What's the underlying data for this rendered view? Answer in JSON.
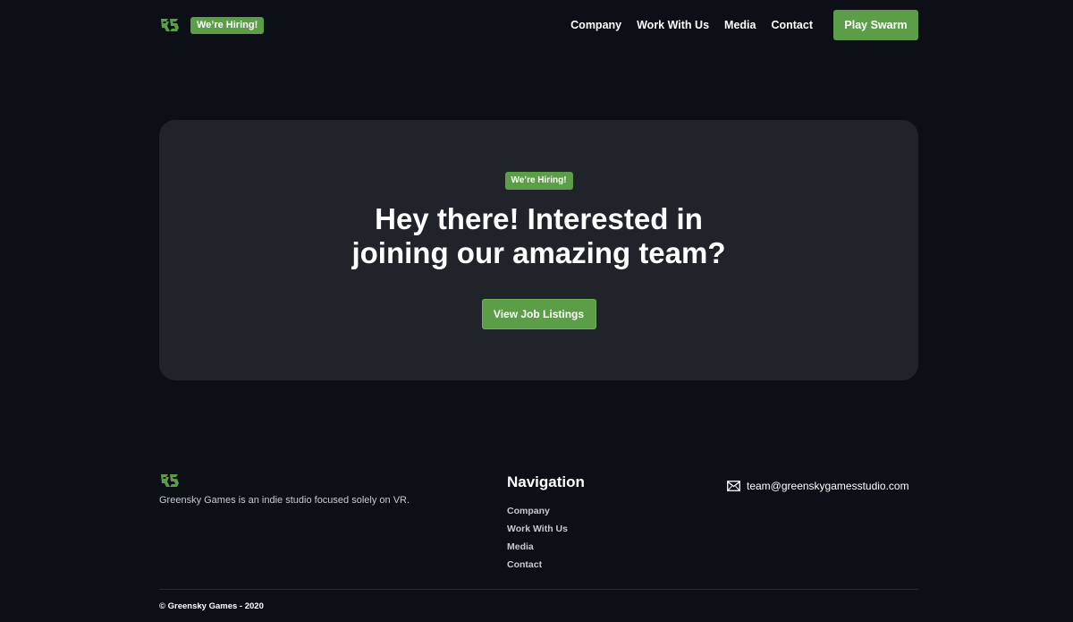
{
  "header": {
    "logo_icon": "greensky-logo-icon",
    "badge": "We’re Hiring!",
    "nav": [
      "Company",
      "Work With Us",
      "Media",
      "Contact"
    ],
    "cta": "Play Swarm"
  },
  "hero": {
    "badge": "We’re Hiring!",
    "title_line1": "Hey there! Interested in",
    "title_line2": "joining our amazing team?",
    "button": "View Job Listings"
  },
  "footer": {
    "logo_icon": "greensky-logo-icon",
    "description": "Greensky Games is an indie studio focused solely on VR.",
    "nav_title": "Navigation",
    "nav": [
      "Company",
      "Work With Us",
      "Media",
      "Contact"
    ],
    "email_icon": "mail-icon",
    "email": "team@greenskygamesstudio.com",
    "copyright": "© Greensky Games - 2020"
  },
  "colors": {
    "background": "#0c0f16",
    "card": "#21232b",
    "accent": "#5c9e48",
    "text": "#ffffff",
    "muted_text": "#c8cad0"
  }
}
